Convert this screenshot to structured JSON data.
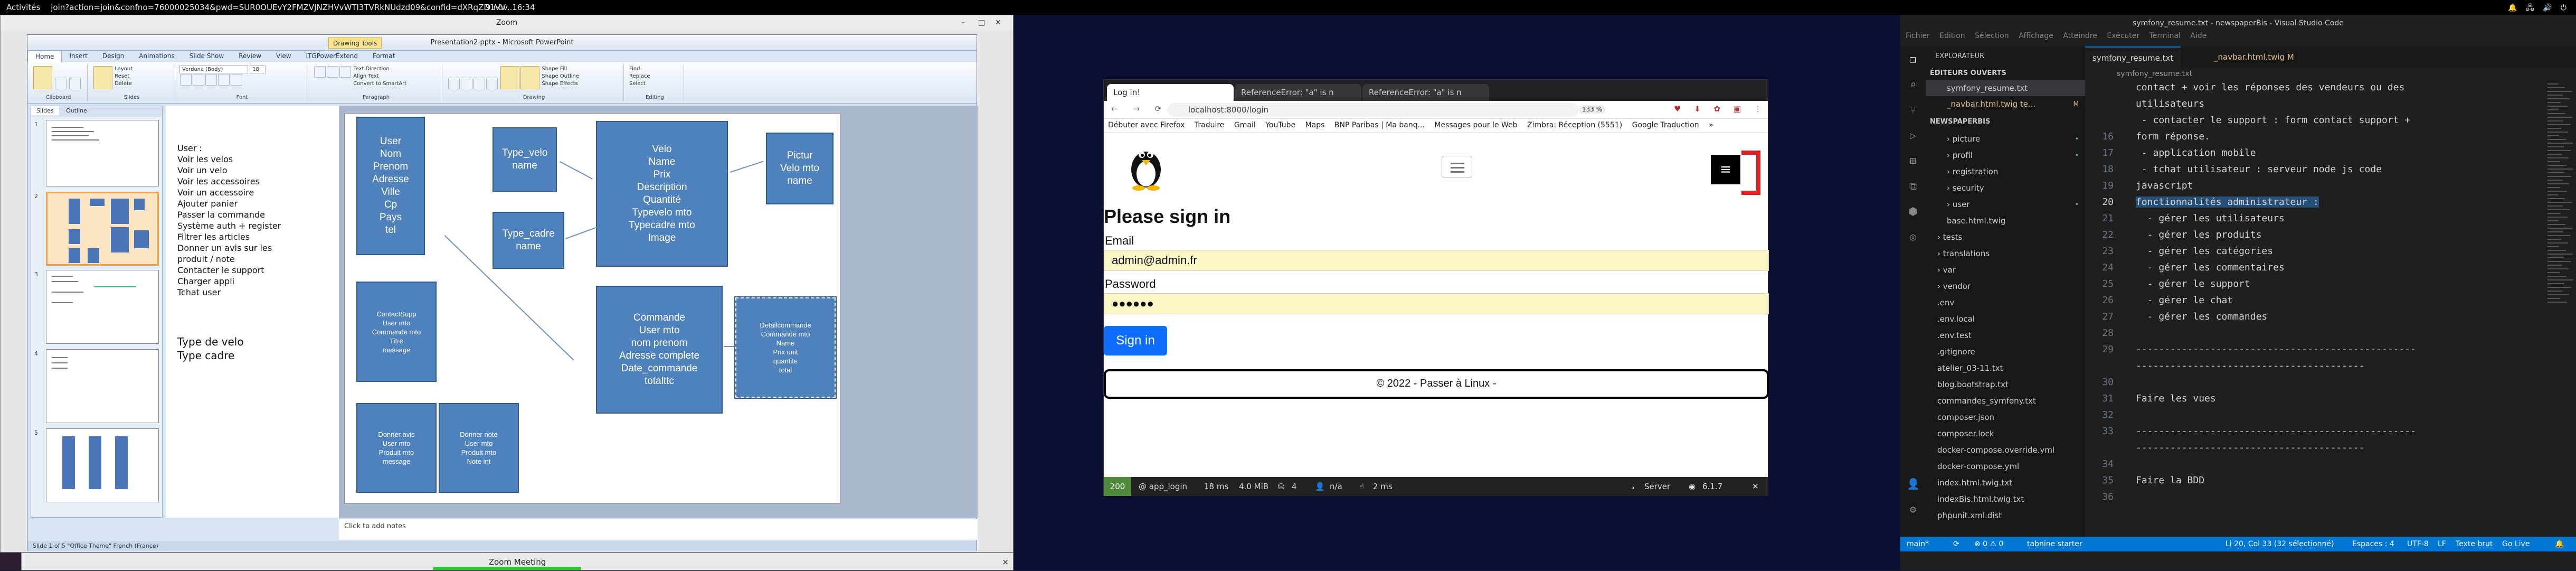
{
  "topbar": {
    "activities": "Activités",
    "app_title": "join?action=join&confno=76000025034&pwd=SUR0OUEvY2FMZVJNZHVvWTI3TVRkNUdzd09&confid=dXRqZD1VV...",
    "clock": "9 nov. 16:34",
    "tray": "🔔 🖧 🔊 ⏻"
  },
  "zoom": {
    "title": "Zoom",
    "bottom_title": "Zoom Meeting",
    "close": "×"
  },
  "ppt": {
    "app_title": "Presentation2.pptx - Microsoft PowerPoint",
    "context_tab": "Drawing Tools",
    "tabs": [
      "Home",
      "Insert",
      "Design",
      "Animations",
      "Slide Show",
      "Review",
      "View",
      "ITGPowerExtend",
      "Format"
    ],
    "groups": [
      {
        "label": "Clipboard",
        "items": [
          "Paste"
        ]
      },
      {
        "label": "Slides",
        "items": [
          "New Slide",
          "Layout",
          "Reset",
          "Delete"
        ]
      },
      {
        "label": "Font",
        "items": [
          "Verdana (Body)",
          "18"
        ]
      },
      {
        "label": "Paragraph",
        "items": [
          "Text Direction",
          "Align Text",
          "Convert to SmartArt"
        ]
      },
      {
        "label": "Drawing",
        "items": [
          "Arrange",
          "Quick Styles",
          "Shape Fill",
          "Shape Outline",
          "Shape Effects"
        ]
      },
      {
        "label": "Editing",
        "items": [
          "Find",
          "Replace",
          "Select"
        ]
      }
    ],
    "panel_tabs": [
      "Slides",
      "Outline"
    ],
    "slide_numbers": [
      "1",
      "2",
      "3",
      "4",
      "5"
    ],
    "notes_lines": [
      "User :",
      "Voir les velos",
      "Voir un velo",
      "Voir les accessoires",
      "Voir un accessoire",
      "Ajouter panier",
      "Passer la commande",
      "Système auth + register",
      "Filtrer les articles",
      "Donner un avis sur les",
      "produit / note",
      "Contacter le support",
      "Charger appli",
      "Tchat user"
    ],
    "notes_lines2": [
      "Type de velo",
      "Type cadre"
    ],
    "boxes": {
      "user": "User\nNom\nPrenom\nAdresse\nVille\nCp\nPays\ntel",
      "type_velo": "Type_velo\nname",
      "type_cadre": "Type_cadre\nname",
      "velo": "Velo\nName\nPrix\nDescription\nQuantité\nTypevelo mto\nTypecadre mto\nImage",
      "picture": "Pictur\nVelo mto\nname",
      "contact": "ContactSupp\nUser mto\nCommande mto\nTitre\nmessage",
      "commande": "Commande\nUser mto\nnom prenom\nAdresse complete\nDate_commande\ntotalttc",
      "detail": "Detailcommande\nCommande mto\nName\nPrix unit\nquantite\ntotal",
      "avis": "Donner avis\nUser mto\nProduit mto\nmessage",
      "note": "Donner note\nUser mto\nProduit mto\nNote int"
    },
    "click_notes": "Click to add notes",
    "status": "Slide 1 of 5   \"Office Theme\"   French (France)"
  },
  "browser": {
    "tabs": [
      "Log in!",
      "ReferenceError: \"a\" is n",
      "ReferenceError: \"a\" is n"
    ],
    "url": "localhost:8000/login",
    "zoom": "133 %",
    "nav_icons": "← → ⟳",
    "ext_icons": "♥ ⬇ ✿ ▣ ⋮",
    "bookmarks": [
      "Débuter avec Firefox",
      "Traduire",
      "Gmail",
      "YouTube",
      "Maps",
      "BNP Paribas | Ma banq...",
      "Messages pour le Web",
      "Zimbra: Réception (5551)",
      "Google Traduction",
      "»"
    ],
    "heading": "Please sign in",
    "email_label": "Email",
    "email_value": "admin@admin.fr",
    "password_label": "Password",
    "password_value": "●●●●●●",
    "signin_button": "Sign in",
    "footer": "© 2022 - Passer à Linux -",
    "burger": "≡",
    "profiler": {
      "status": "200",
      "route": "@ app_login",
      "time": "18 ms",
      "memory": "4.0 MiB",
      "layers": "4",
      "user": "n/a",
      "time2": "2 ms",
      "server": "Server",
      "version": "6.1.7",
      "close": "✕"
    }
  },
  "vscode": {
    "title": "symfony_resume.txt - newspaperBis - Visual Studio Code",
    "menu": [
      "Fichier",
      "Edition",
      "Sélection",
      "Affichage",
      "Atteindre",
      "Exécuter",
      "Terminal",
      "Aide"
    ],
    "explorer_title": "EXPLORATEUR",
    "open_editors": "ÉDITEURS OUVERTS",
    "open_files": [
      {
        "name": "symfony_resume.txt",
        "dot": ""
      },
      {
        "name": "_navbar.html.twig te...",
        "dot": "M"
      }
    ],
    "project": "NEWSPAPERBIS",
    "tree": [
      {
        "name": "picture",
        "dot": "•"
      },
      {
        "name": "profil",
        "dot": "•"
      },
      {
        "name": "registration",
        "dot": ""
      },
      {
        "name": "security",
        "dot": ""
      },
      {
        "name": "user",
        "dot": "•"
      },
      {
        "name": "base.html.twig",
        "dot": ""
      },
      {
        "name": "tests",
        "dot": ""
      },
      {
        "name": "translations",
        "dot": ""
      },
      {
        "name": "var",
        "dot": ""
      },
      {
        "name": "vendor",
        "dot": ""
      },
      {
        "name": ".env",
        "dot": ""
      },
      {
        "name": ".env.local",
        "dot": ""
      },
      {
        "name": ".env.test",
        "dot": ""
      },
      {
        "name": ".gitignore",
        "dot": ""
      },
      {
        "name": "atelier_03-11.txt",
        "dot": ""
      },
      {
        "name": "blog.bootstrap.txt",
        "dot": ""
      },
      {
        "name": "commandes_symfony.txt",
        "dot": ""
      },
      {
        "name": "composer.json",
        "dot": ""
      },
      {
        "name": "composer.lock",
        "dot": ""
      },
      {
        "name": "docker-compose.override.yml",
        "dot": ""
      },
      {
        "name": "docker-compose.yml",
        "dot": ""
      },
      {
        "name": "index.html.twig.txt",
        "dot": ""
      },
      {
        "name": "indexBis.html.twig.txt",
        "dot": ""
      },
      {
        "name": "phpunit.xml.dist",
        "dot": ""
      }
    ],
    "editor_tabs": [
      "symfony_resume.txt",
      "_navbar.html.twig M"
    ],
    "breadcrumb": "symfony_resume.txt",
    "code": [
      {
        "n": "",
        "t": "contact + voir les réponses des vendeurs ou des"
      },
      {
        "n": "",
        "t": "utilisateurs"
      },
      {
        "n": "",
        "t": " - contacter le support : form contact support +"
      },
      {
        "n": "16",
        "t": "form réponse."
      },
      {
        "n": "17",
        "t": " - application mobile"
      },
      {
        "n": "18",
        "t": " - tchat utilisateur : serveur node js code"
      },
      {
        "n": "19",
        "t": "javascript"
      },
      {
        "n": "20",
        "t": "fonctionnalités administrateur :",
        "sel": true
      },
      {
        "n": "21",
        "t": "  - gérer les utilisateurs"
      },
      {
        "n": "22",
        "t": "  - gérer les produits"
      },
      {
        "n": "23",
        "t": "  - gérer les catégories"
      },
      {
        "n": "24",
        "t": "  - gérer les commentaires"
      },
      {
        "n": "25",
        "t": "  - gérer le support"
      },
      {
        "n": "26",
        "t": "  - gérer le chat"
      },
      {
        "n": "27",
        "t": "  - gérer les commandes"
      },
      {
        "n": "28",
        "t": ""
      },
      {
        "n": "29",
        "t": "-------------------------------------------------"
      },
      {
        "n": "",
        "t": "----------------------------------------"
      },
      {
        "n": "30",
        "t": ""
      },
      {
        "n": "31",
        "t": "Faire les vues"
      },
      {
        "n": "32",
        "t": ""
      },
      {
        "n": "33",
        "t": "-------------------------------------------------"
      },
      {
        "n": "",
        "t": "----------------------------------------"
      },
      {
        "n": "34",
        "t": ""
      },
      {
        "n": "35",
        "t": "Faire la BDD"
      },
      {
        "n": "36",
        "t": ""
      }
    ],
    "status": {
      "branch": "main*",
      "sync": "⟳",
      "errors": "⊗ 0 ⚠ 0",
      "tabnine": "tabnine starter",
      "position": "Li 20, Col 33 (32 sélectionné)",
      "spaces": "Espaces : 4",
      "encoding": "UTF-8",
      "eol": "LF",
      "lang": "Texte brut",
      "live": "Go Live",
      "bell": "🔔"
    }
  }
}
